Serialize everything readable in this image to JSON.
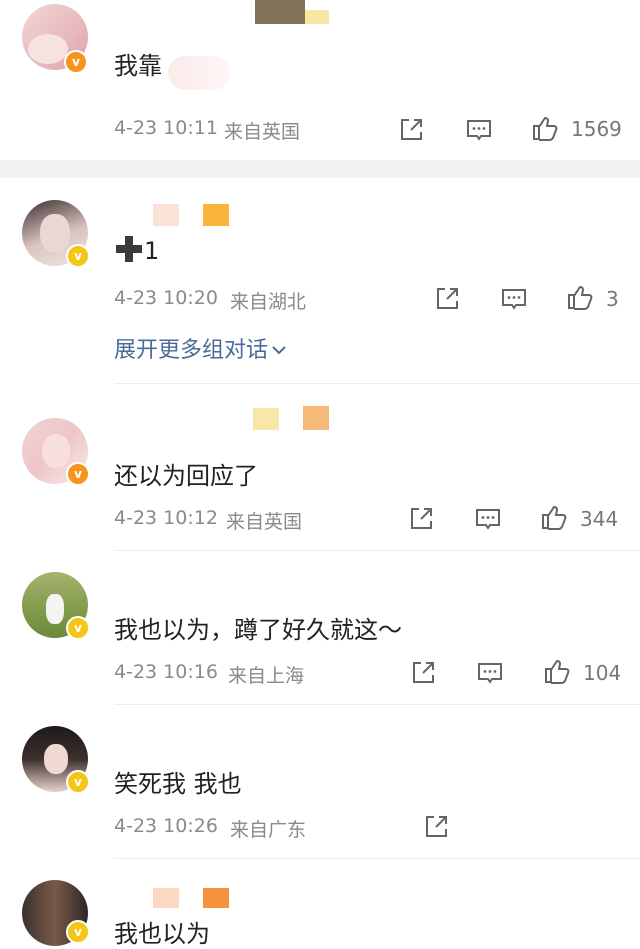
{
  "comments": [
    {
      "text": "我靠",
      "time": "4-23 10:11",
      "location": "来自英国",
      "likes": "1569",
      "badge": "orange-v-badge"
    },
    {
      "text": "1",
      "time": "4-23 10:20",
      "location": "来自湖北",
      "likes": "3",
      "badge": "gold-v-badge",
      "expand": "展开更多组对话"
    },
    {
      "text": "还以为回应了",
      "time": "4-23 10:12",
      "location": "来自英国",
      "likes": "344",
      "badge": "orange-v-badge"
    },
    {
      "text": "我也以为，蹲了好久就这～",
      "time": "4-23 10:16",
      "location": "来自上海",
      "likes": "104",
      "badge": "gold-v-badge"
    },
    {
      "text": "笑死我 我也",
      "time": "4-23 10:26",
      "location": "来自广东",
      "badge": "gold-v-badge"
    },
    {
      "text": "我也以为",
      "badge": "gold-v-badge"
    }
  ],
  "icons": {
    "share": "share-icon",
    "comment": "comment-icon",
    "like": "thumbs-up-icon",
    "plus": "plus-emoji-icon"
  },
  "colors": {
    "link": "#4a6b9a",
    "badge_orange": "#f7941d",
    "badge_gold": "#f5c518",
    "meta": "#8a8a8a"
  }
}
